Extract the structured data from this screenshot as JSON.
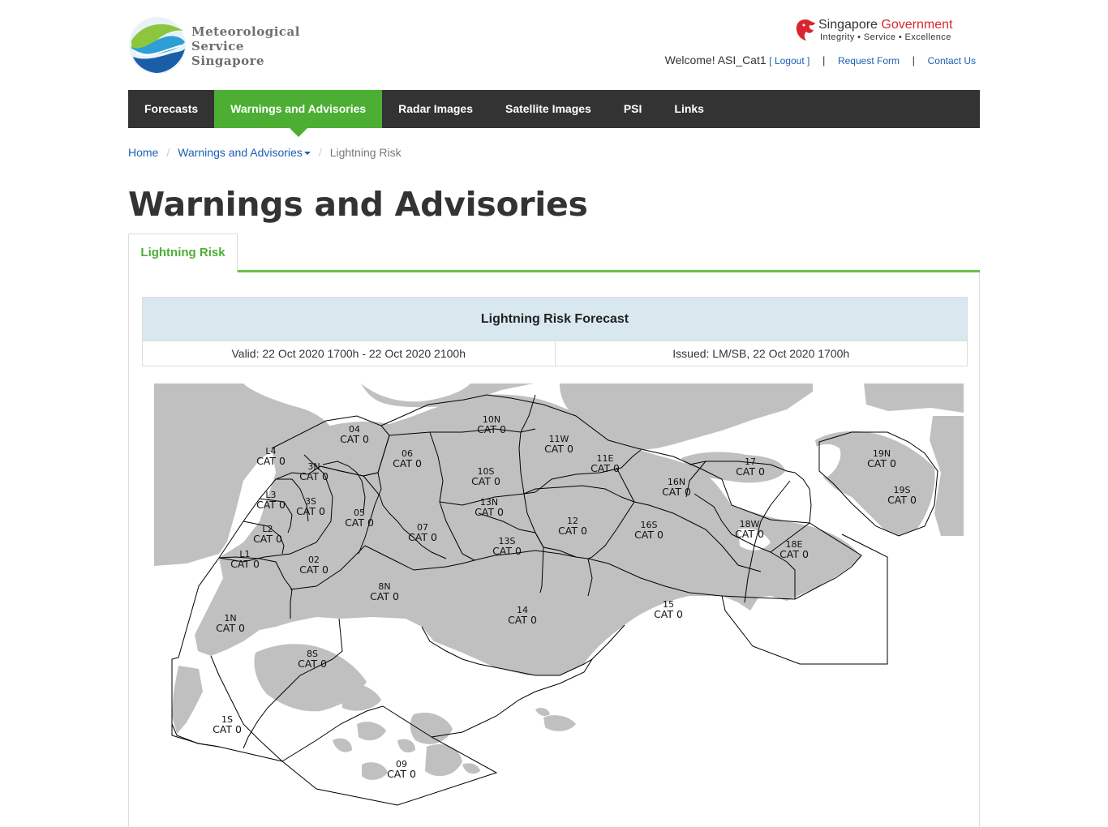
{
  "header": {
    "logo": {
      "line1": "Meteorological",
      "line2": "Service",
      "line3": "Singapore",
      "icon": "mss-wave-logo"
    },
    "gov": {
      "name_part1": "Singapore",
      "name_part2": "Government",
      "tagline": "Integrity • Service • Excellence",
      "icon": "merlion-icon"
    },
    "welcome": "Welcome! ASI_Cat1",
    "logout": "[ Logout ]",
    "request_form": "Request Form",
    "contact_us": "Contact Us",
    "separator": "|"
  },
  "nav": {
    "items": [
      "Forecasts",
      "Warnings and Advisories",
      "Radar Images",
      "Satellite Images",
      "PSI",
      "Links"
    ],
    "active": "Warnings and Advisories"
  },
  "breadcrumb": {
    "home": "Home",
    "section": "Warnings and Advisories",
    "current": "Lightning Risk",
    "divider": "/"
  },
  "page": {
    "title": "Warnings and Advisories",
    "tab": "Lightning Risk"
  },
  "forecast": {
    "heading": "Lightning Risk Forecast",
    "valid": "Valid: 22 Oct 2020 1700h - 22 Oct 2020 2100h",
    "issued": "Issued: LM/SB, 22 Oct 2020 1700h"
  },
  "map": {
    "land_color": "#c0c0c0",
    "zones": [
      {
        "id": "04",
        "cat": "CAT 0"
      },
      {
        "id": "L4",
        "cat": "CAT 0"
      },
      {
        "id": "3N",
        "cat": "CAT 0"
      },
      {
        "id": "06",
        "cat": "CAT 0"
      },
      {
        "id": "10N",
        "cat": "CAT 0"
      },
      {
        "id": "11W",
        "cat": "CAT 0"
      },
      {
        "id": "11E",
        "cat": "CAT 0"
      },
      {
        "id": "10S",
        "cat": "CAT 0"
      },
      {
        "id": "17",
        "cat": "CAT 0"
      },
      {
        "id": "19N",
        "cat": "CAT 0"
      },
      {
        "id": "19S",
        "cat": "CAT 0"
      },
      {
        "id": "L3",
        "cat": "CAT 0"
      },
      {
        "id": "3S",
        "cat": "CAT 0"
      },
      {
        "id": "05",
        "cat": "CAT 0"
      },
      {
        "id": "13N",
        "cat": "CAT 0"
      },
      {
        "id": "16N",
        "cat": "CAT 0"
      },
      {
        "id": "L2",
        "cat": "CAT 0"
      },
      {
        "id": "07",
        "cat": "CAT 0"
      },
      {
        "id": "12",
        "cat": "CAT 0"
      },
      {
        "id": "16S",
        "cat": "CAT 0"
      },
      {
        "id": "18W",
        "cat": "CAT 0"
      },
      {
        "id": "L1",
        "cat": "CAT 0"
      },
      {
        "id": "02",
        "cat": "CAT 0"
      },
      {
        "id": "13S",
        "cat": "CAT 0"
      },
      {
        "id": "18E",
        "cat": "CAT 0"
      },
      {
        "id": "8N",
        "cat": "CAT 0"
      },
      {
        "id": "14",
        "cat": "CAT 0"
      },
      {
        "id": "15",
        "cat": "CAT 0"
      },
      {
        "id": "1N",
        "cat": "CAT 0"
      },
      {
        "id": "8S",
        "cat": "CAT 0"
      },
      {
        "id": "1S",
        "cat": "CAT 0"
      },
      {
        "id": "09",
        "cat": "CAT 0"
      }
    ]
  }
}
